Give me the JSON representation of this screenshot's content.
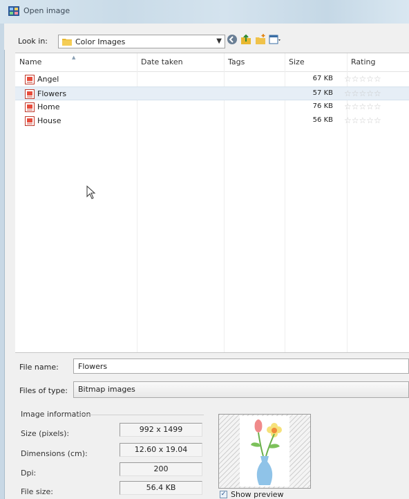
{
  "window": {
    "title": "Open image"
  },
  "lookin": {
    "label": "Look in:",
    "folder": "Color Images"
  },
  "list": {
    "columns": [
      "Name",
      "Date taken",
      "Tags",
      "Size",
      "Rating"
    ],
    "rows": [
      {
        "name": "Angel",
        "date": "",
        "tags": "",
        "size": "67 KB",
        "rating_stars": "☆☆☆☆☆",
        "selected": false
      },
      {
        "name": "Flowers",
        "date": "",
        "tags": "",
        "size": "57 KB",
        "rating_stars": "☆☆☆☆☆",
        "selected": true
      },
      {
        "name": "Home",
        "date": "",
        "tags": "",
        "size": "76 KB",
        "rating_stars": "☆☆☆☆☆",
        "selected": false
      },
      {
        "name": "House",
        "date": "",
        "tags": "",
        "size": "56 KB",
        "rating_stars": "☆☆☆☆☆",
        "selected": false
      }
    ]
  },
  "filename": {
    "label": "File name:",
    "value": "Flowers"
  },
  "filetype": {
    "label": "Files of type:",
    "value": "Bitmap images"
  },
  "info": {
    "title": "Image information",
    "size_label": "Size (pixels):",
    "size_value": "992 x 1499",
    "dim_label": "Dimensions (cm):",
    "dim_value": "12.60 x 19.04",
    "dpi_label": "Dpi:",
    "dpi_value": "200",
    "file_label": "File size:",
    "file_value": "56.4 KB"
  },
  "preview": {
    "show_label": "Show preview",
    "checked": true
  },
  "colors": {
    "selected_row": "#e6eef6",
    "titlebar": "#cfe0ec",
    "folder": "#e8b830"
  }
}
